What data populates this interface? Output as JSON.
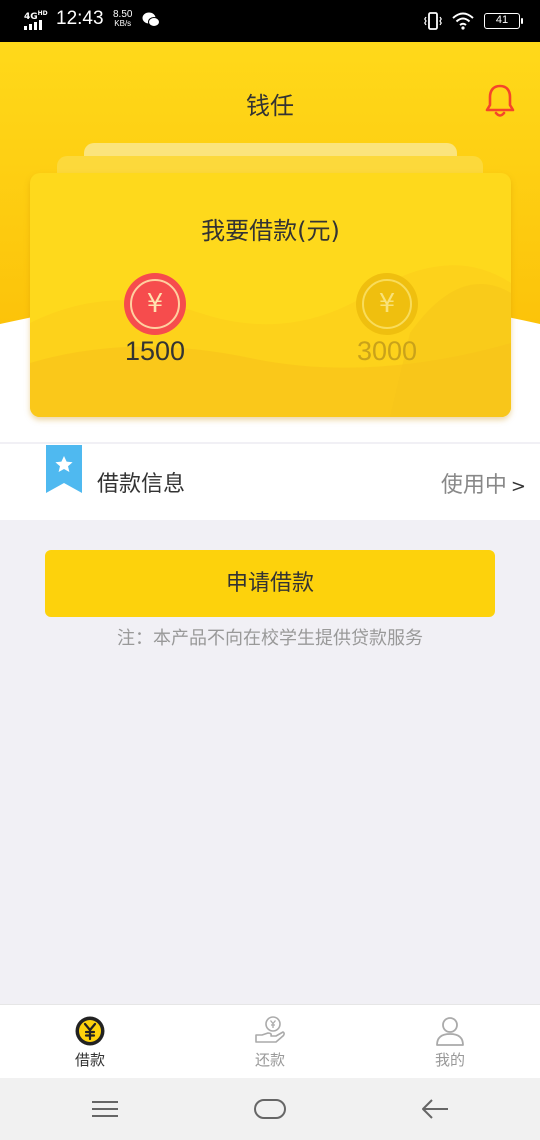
{
  "status_bar": {
    "network": "4G",
    "network_hd": "HD",
    "time": "12:43",
    "speed_value": "8.50",
    "speed_unit": "KB/s",
    "battery": "41",
    "icons": [
      "wechat-icon",
      "vibrate-icon",
      "wifi-icon",
      "battery-icon"
    ]
  },
  "header": {
    "title": "钱任",
    "bell_icon": "bell-icon"
  },
  "loan_card": {
    "title": "我要借款(元)",
    "options": [
      {
        "symbol": "¥",
        "amount": "1500",
        "selected": true
      },
      {
        "symbol": "¥",
        "amount": "3000",
        "selected": false
      }
    ]
  },
  "info_row": {
    "icon": "bookmark-star-icon",
    "label": "借款信息",
    "status": "使用中",
    "chevron": ">"
  },
  "apply": {
    "button_label": "申请借款",
    "note": "注：本产品不向在校学生提供贷款服务"
  },
  "tabs": [
    {
      "label": "借款",
      "icon": "yen-coin-icon",
      "active": true
    },
    {
      "label": "还款",
      "icon": "repay-hand-icon",
      "active": false
    },
    {
      "label": "我的",
      "icon": "user-icon",
      "active": false
    }
  ],
  "colors": {
    "accent_yellow": "#fdd20c",
    "header_gradient_top": "#ffd91a",
    "header_gradient_bottom": "#fcc30a",
    "selected_coin": "#f64c4d",
    "bell": "#f5452a",
    "bookmark": "#4fb9f0"
  }
}
